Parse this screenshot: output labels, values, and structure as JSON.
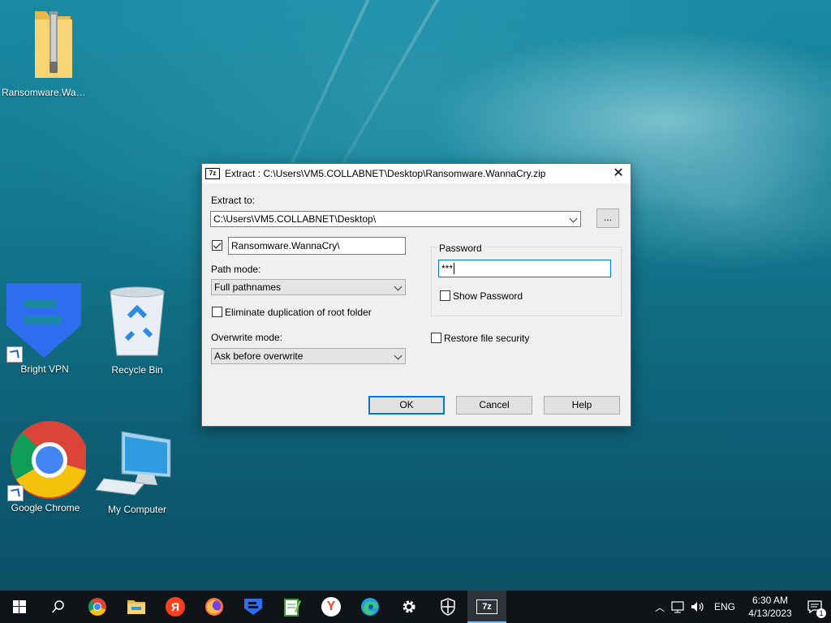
{
  "desktop": {
    "icons": [
      {
        "label": "Ransomware.Wann..."
      },
      {
        "label": "Bright VPN"
      },
      {
        "label": "Recycle Bin"
      },
      {
        "label": "Google Chrome"
      },
      {
        "label": "My Computer"
      }
    ]
  },
  "dialog": {
    "title": "Extract : C:\\Users\\VM5.COLLABNET\\Desktop\\Ransomware.WannaCry.zip",
    "logo_text": "7z",
    "extract_to_label": "Extract to:",
    "extract_to_value": "C:\\Users\\VM5.COLLABNET\\Desktop\\",
    "browse_label": "...",
    "folder_name_value": "Ransomware.WannaCry\\",
    "folder_checked": true,
    "path_mode_label": "Path mode:",
    "path_mode_value": "Full pathnames",
    "eliminate_dup_label": "Eliminate duplication of root folder",
    "overwrite_mode_label": "Overwrite mode:",
    "overwrite_mode_value": "Ask before overwrite",
    "password_group_label": "Password",
    "password_value": "***",
    "show_password_label": "Show Password",
    "restore_security_label": "Restore file security",
    "ok_label": "OK",
    "cancel_label": "Cancel",
    "help_label": "Help"
  },
  "taskbar": {
    "active_app_label": "7z",
    "lang": "ENG",
    "time": "6:30 AM",
    "date": "4/13/2023",
    "notification_count": "1",
    "yandex_label": "Я"
  },
  "colors": {
    "accent": "#0078d7",
    "taskbar": "#101418"
  }
}
